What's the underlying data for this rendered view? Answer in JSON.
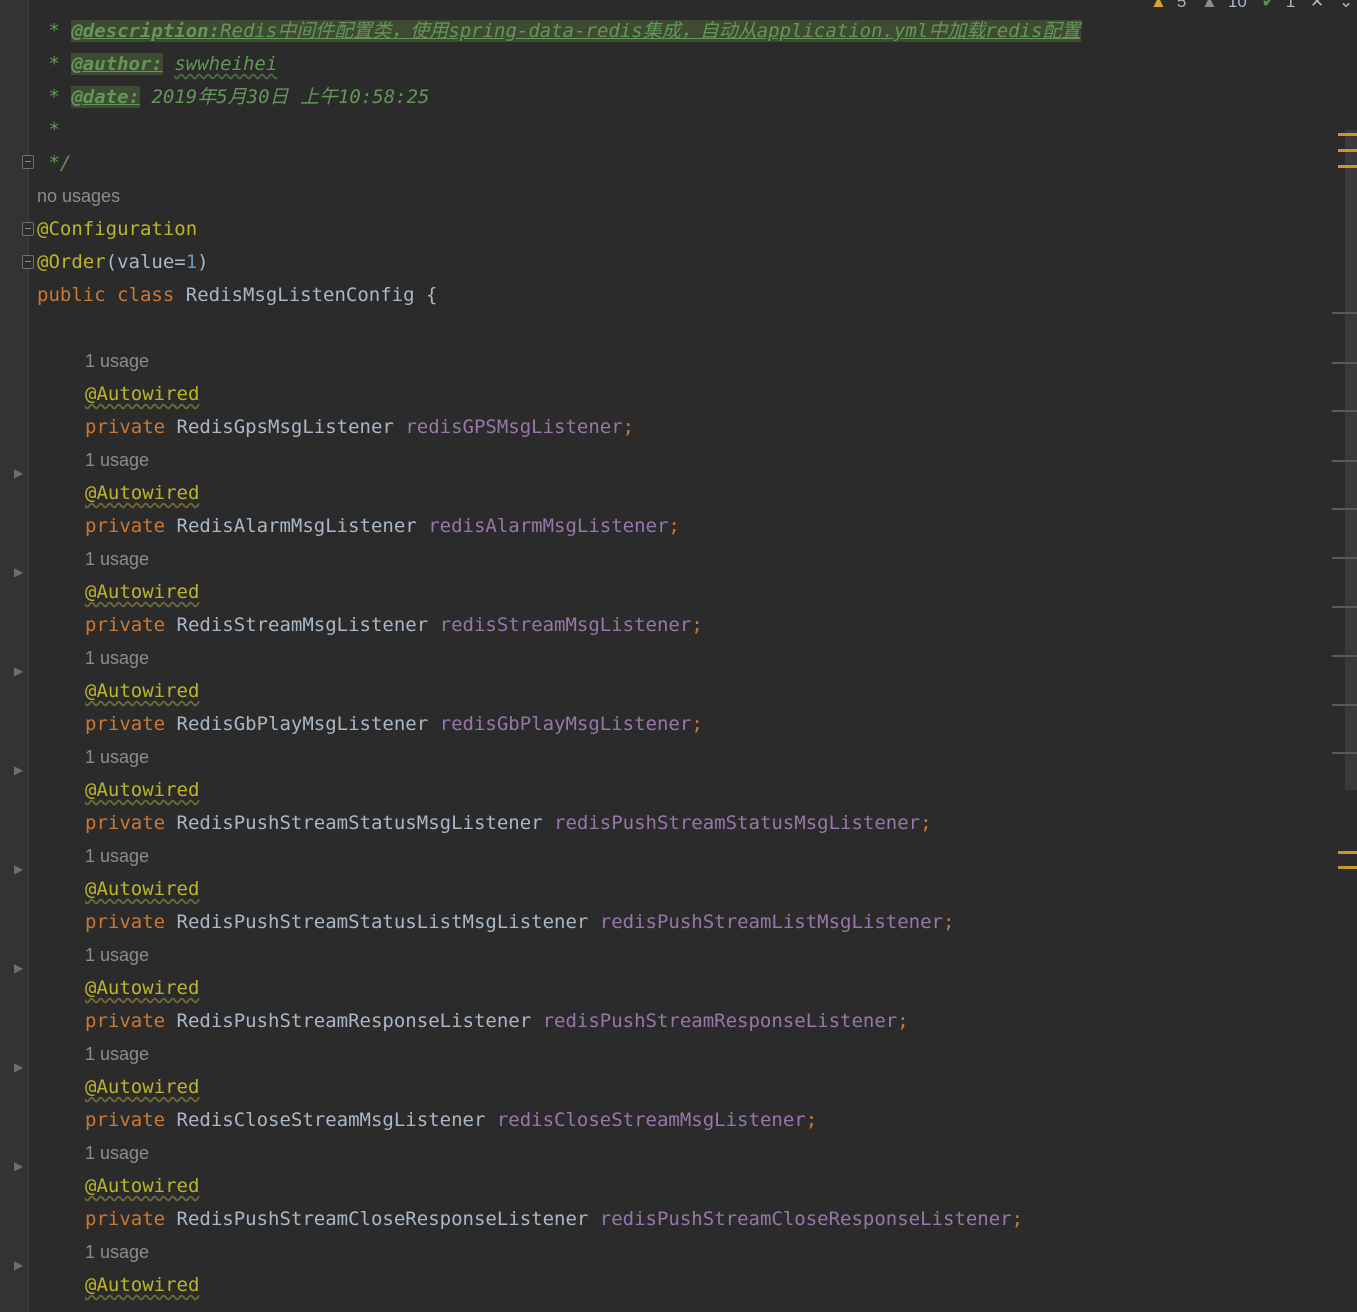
{
  "status": {
    "warnings": "5",
    "weak_warnings": "10",
    "ok": "1"
  },
  "doc": {
    "desc_tag": "@description:",
    "desc_text": "Redis中间件配置类，使用spring-data-redis集成，自动从application.yml中加载redis配置",
    "author_tag": "@author:",
    "author_val": "swwheihei",
    "date_tag": "@date:",
    "date_val": "2019年5月30日 上午10:58:25",
    "star": " *",
    "end": " */"
  },
  "class_decl": {
    "usages": "no usages",
    "ann1": "@Configuration",
    "ann2": "@Order",
    "order_open": "(value=",
    "order_val": "1",
    "order_close": ")",
    "kw_public": "public",
    "kw_class": "class",
    "name": "RedisMsgListenConfig",
    "brace": "{"
  },
  "fields": [
    {
      "usage": "1 usage",
      "ann": "@Autowired",
      "kw": "private",
      "type": "RedisGpsMsgListener",
      "name": "redisGPSMsgListener"
    },
    {
      "usage": "1 usage",
      "ann": "@Autowired",
      "kw": "private",
      "type": "RedisAlarmMsgListener",
      "name": "redisAlarmMsgListener"
    },
    {
      "usage": "1 usage",
      "ann": "@Autowired",
      "kw": "private",
      "type": "RedisStreamMsgListener",
      "name": "redisStreamMsgListener"
    },
    {
      "usage": "1 usage",
      "ann": "@Autowired",
      "kw": "private",
      "type": "RedisGbPlayMsgListener",
      "name": "redisGbPlayMsgListener"
    },
    {
      "usage": "1 usage",
      "ann": "@Autowired",
      "kw": "private",
      "type": "RedisPushStreamStatusMsgListener",
      "name": "redisPushStreamStatusMsgListener"
    },
    {
      "usage": "1 usage",
      "ann": "@Autowired",
      "kw": "private",
      "type": "RedisPushStreamStatusListMsgListener",
      "name": "redisPushStreamListMsgListener"
    },
    {
      "usage": "1 usage",
      "ann": "@Autowired",
      "kw": "private",
      "type": "RedisPushStreamResponseListener",
      "name": "redisPushStreamResponseListener"
    },
    {
      "usage": "1 usage",
      "ann": "@Autowired",
      "kw": "private",
      "type": "RedisCloseStreamMsgListener",
      "name": "redisCloseStreamMsgListener"
    },
    {
      "usage": "1 usage",
      "ann": "@Autowired",
      "kw": "private",
      "type": "RedisPushStreamCloseResponseListener",
      "name": "redisPushStreamCloseResponseListener"
    },
    {
      "usage": "1 usage",
      "ann": "@Autowired"
    }
  ],
  "semicolon": ";"
}
